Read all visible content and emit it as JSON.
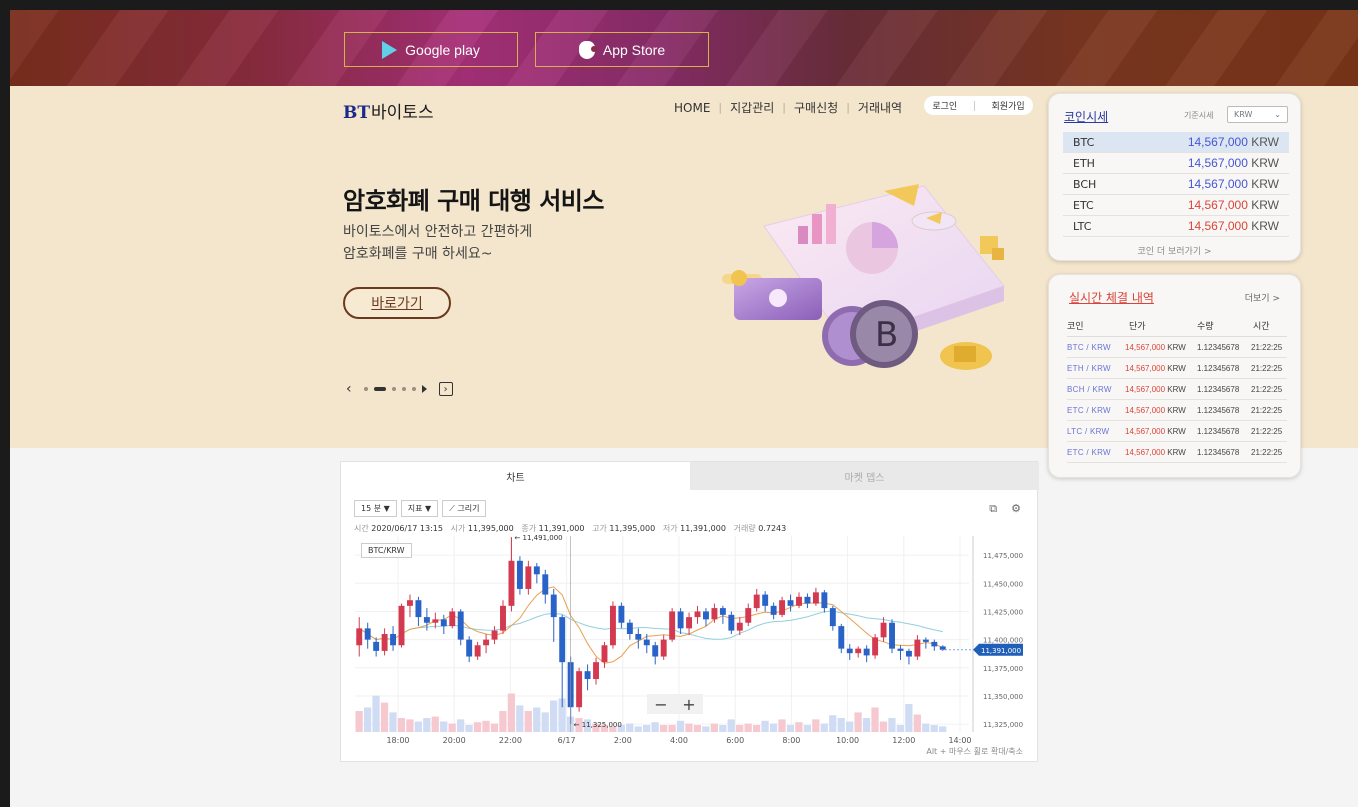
{
  "store": {
    "google_play": "Google play",
    "app_store": "App Store"
  },
  "brand": {
    "bt": "BT",
    "name": "바이토스"
  },
  "nav": [
    "HOME",
    "지갑관리",
    "구매신청",
    "거래내역"
  ],
  "auth": {
    "login": "로그인",
    "signup": "회원가입"
  },
  "hero": {
    "title": "암호화폐 구매 대행 서비스",
    "subtitle_line1": "바이토스에서 안전하고 간편하게",
    "subtitle_line2": "암호화폐를 구매 하세요~",
    "cta": "바로가기"
  },
  "coin_prices": {
    "title": "코인시세",
    "base_label": "기준시세",
    "currency": "KRW",
    "more": "코인 더 보러가기 >",
    "rows": [
      {
        "coin": "BTC",
        "price": "14,567,000",
        "unit": "KRW",
        "color": "blue"
      },
      {
        "coin": "ETH",
        "price": "14,567,000",
        "unit": "KRW",
        "color": "blue"
      },
      {
        "coin": "BCH",
        "price": "14,567,000",
        "unit": "KRW",
        "color": "blue"
      },
      {
        "coin": "ETC",
        "price": "14,567,000",
        "unit": "KRW",
        "color": "red"
      },
      {
        "coin": "LTC",
        "price": "14,567,000",
        "unit": "KRW",
        "color": "red"
      }
    ]
  },
  "trades": {
    "title": "실시간 체결 내역",
    "more": "더보기 >",
    "headers": [
      "코인",
      "단가",
      "수량",
      "시간"
    ],
    "rows": [
      {
        "pair": "BTC / KRW",
        "price": "14,567,000",
        "unit": "KRW",
        "qty": "1.12345678",
        "time": "21:22:25"
      },
      {
        "pair": "ETH / KRW",
        "price": "14,567,000",
        "unit": "KRW",
        "qty": "1.12345678",
        "time": "21:22:25"
      },
      {
        "pair": "BCH / KRW",
        "price": "14,567,000",
        "unit": "KRW",
        "qty": "1.12345678",
        "time": "21:22:25"
      },
      {
        "pair": "ETC / KRW",
        "price": "14,567,000",
        "unit": "KRW",
        "qty": "1.12345678",
        "time": "21:22:25"
      },
      {
        "pair": "LTC / KRW",
        "price": "14,567,000",
        "unit": "KRW",
        "qty": "1.12345678",
        "time": "21:22:25"
      },
      {
        "pair": "ETC / KRW",
        "price": "14,567,000",
        "unit": "KRW",
        "qty": "1.12345678",
        "time": "21:22:25"
      }
    ]
  },
  "chart_panel": {
    "tabs": [
      "차트",
      "마켓 뎁스"
    ],
    "interval": "15 분 ▼",
    "indicator": "지표 ▼",
    "draw": "⟋ 그리기",
    "pair": "BTC/KRW",
    "ohlc": {
      "time_label": "시간",
      "time": "2020/06/17 13:15",
      "open_label": "시가",
      "open": "11,395,000",
      "close_label": "종가",
      "close": "11,391,000",
      "high_label": "고가",
      "high": "11,395,000",
      "low_label": "저가",
      "low": "11,391,000",
      "vol_label": "거래량",
      "vol": "0.7243"
    },
    "hint": "Alt + 마우스 휠로 확대/축소",
    "zoom_minus": "−",
    "zoom_plus": "+"
  },
  "chart_data": {
    "type": "candlestick",
    "x_ticks": [
      "18:00",
      "20:00",
      "22:00",
      "6/17",
      "2:00",
      "4:00",
      "6:00",
      "8:00",
      "10:00",
      "12:00",
      "14:00"
    ],
    "y_ticks": [
      "11,475,000",
      "11,450,000",
      "11,425,000",
      "11,400,000",
      "11,375,000",
      "11,350,000",
      "11,325,000"
    ],
    "ylim": [
      11318000,
      11492000
    ],
    "current_price": "11,391,000",
    "max_label": "11,491,000",
    "min_label": "11,325,000",
    "up_color": "#d33a50",
    "down_color": "#2a63c8",
    "candles": [
      [
        11395000,
        11410000,
        11385000,
        11420000
      ],
      [
        11410000,
        11400000,
        11392000,
        11415000
      ],
      [
        11398000,
        11390000,
        11385000,
        11402000
      ],
      [
        11390000,
        11405000,
        11386000,
        11410000
      ],
      [
        11405000,
        11395000,
        11390000,
        11412000
      ],
      [
        11395000,
        11430000,
        11393000,
        11432000
      ],
      [
        11430000,
        11435000,
        11420000,
        11440000
      ],
      [
        11435000,
        11420000,
        11412000,
        11438000
      ],
      [
        11420000,
        11415000,
        11408000,
        11428000
      ],
      [
        11415000,
        11418000,
        11410000,
        11424000
      ],
      [
        11418000,
        11412000,
        11405000,
        11422000
      ],
      [
        11412000,
        11425000,
        11410000,
        11428000
      ],
      [
        11425000,
        11400000,
        11395000,
        11427000
      ],
      [
        11400000,
        11385000,
        11380000,
        11403000
      ],
      [
        11385000,
        11395000,
        11382000,
        11398000
      ],
      [
        11395000,
        11400000,
        11388000,
        11405000
      ],
      [
        11400000,
        11408000,
        11396000,
        11412000
      ],
      [
        11408000,
        11430000,
        11405000,
        11435000
      ],
      [
        11430000,
        11470000,
        11425000,
        11491000
      ],
      [
        11470000,
        11445000,
        11440000,
        11474000
      ],
      [
        11445000,
        11465000,
        11440000,
        11470000
      ],
      [
        11465000,
        11458000,
        11450000,
        11468000
      ],
      [
        11458000,
        11440000,
        11432000,
        11462000
      ],
      [
        11440000,
        11420000,
        11398000,
        11445000
      ],
      [
        11420000,
        11380000,
        11340000,
        11422000
      ],
      [
        11380000,
        11340000,
        11325000,
        11385000
      ],
      [
        11340000,
        11372000,
        11336000,
        11375000
      ],
      [
        11372000,
        11365000,
        11355000,
        11378000
      ],
      [
        11365000,
        11380000,
        11360000,
        11384000
      ],
      [
        11380000,
        11395000,
        11375000,
        11398000
      ],
      [
        11395000,
        11430000,
        11392000,
        11434000
      ],
      [
        11430000,
        11415000,
        11410000,
        11433000
      ],
      [
        11415000,
        11405000,
        11400000,
        11418000
      ],
      [
        11405000,
        11400000,
        11392000,
        11410000
      ],
      [
        11400000,
        11395000,
        11388000,
        11405000
      ],
      [
        11395000,
        11385000,
        11378000,
        11398000
      ],
      [
        11385000,
        11400000,
        11382000,
        11404000
      ],
      [
        11400000,
        11425000,
        11398000,
        11428000
      ],
      [
        11425000,
        11410000,
        11405000,
        11428000
      ],
      [
        11410000,
        11420000,
        11404000,
        11424000
      ],
      [
        11420000,
        11425000,
        11414000,
        11430000
      ],
      [
        11425000,
        11418000,
        11412000,
        11428000
      ],
      [
        11418000,
        11428000,
        11415000,
        11432000
      ],
      [
        11428000,
        11422000,
        11414000,
        11430000
      ],
      [
        11422000,
        11408000,
        11405000,
        11425000
      ],
      [
        11408000,
        11415000,
        11404000,
        11420000
      ],
      [
        11415000,
        11428000,
        11412000,
        11432000
      ],
      [
        11428000,
        11440000,
        11425000,
        11445000
      ],
      [
        11440000,
        11430000,
        11425000,
        11443000
      ],
      [
        11430000,
        11422000,
        11418000,
        11433000
      ],
      [
        11422000,
        11435000,
        11420000,
        11438000
      ],
      [
        11435000,
        11430000,
        11425000,
        11440000
      ],
      [
        11430000,
        11438000,
        11428000,
        11442000
      ],
      [
        11438000,
        11432000,
        11428000,
        11441000
      ],
      [
        11432000,
        11442000,
        11430000,
        11446000
      ],
      [
        11442000,
        11428000,
        11424000,
        11444000
      ],
      [
        11428000,
        11412000,
        11408000,
        11430000
      ],
      [
        11412000,
        11392000,
        11388000,
        11414000
      ],
      [
        11392000,
        11388000,
        11382000,
        11396000
      ],
      [
        11388000,
        11392000,
        11384000,
        11394000
      ],
      [
        11392000,
        11386000,
        11380000,
        11395000
      ],
      [
        11386000,
        11402000,
        11383000,
        11405000
      ],
      [
        11402000,
        11415000,
        11398000,
        11420000
      ],
      [
        11415000,
        11392000,
        11388000,
        11418000
      ],
      [
        11392000,
        11390000,
        11382000,
        11395000
      ],
      [
        11390000,
        11385000,
        11378000,
        11392000
      ],
      [
        11385000,
        11400000,
        11382000,
        11404000
      ],
      [
        11400000,
        11398000,
        11392000,
        11402000
      ],
      [
        11398000,
        11394000,
        11390000,
        11400000
      ],
      [
        11394000,
        11391000,
        11390000,
        11395000
      ]
    ],
    "volumes": [
      0.3,
      0.35,
      0.52,
      0.42,
      0.28,
      0.2,
      0.18,
      0.15,
      0.2,
      0.22,
      0.15,
      0.12,
      0.18,
      0.1,
      0.14,
      0.16,
      0.12,
      0.3,
      0.55,
      0.38,
      0.3,
      0.35,
      0.28,
      0.45,
      0.48,
      0.22,
      0.2,
      0.18,
      0.12,
      0.1,
      0.08,
      0.1,
      0.12,
      0.08,
      0.1,
      0.14,
      0.1,
      0.1,
      0.16,
      0.12,
      0.1,
      0.08,
      0.12,
      0.1,
      0.18,
      0.1,
      0.12,
      0.1,
      0.16,
      0.12,
      0.18,
      0.1,
      0.14,
      0.1,
      0.18,
      0.12,
      0.24,
      0.2,
      0.15,
      0.28,
      0.2,
      0.35,
      0.15,
      0.2,
      0.1,
      0.4,
      0.25,
      0.12,
      0.1,
      0.08
    ],
    "ma_short": "#e8a050",
    "ma_long": "#8fd0dc"
  }
}
